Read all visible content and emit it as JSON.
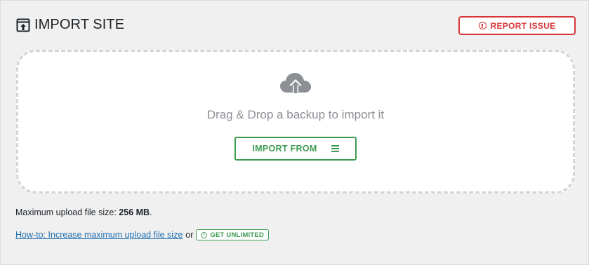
{
  "header": {
    "title": "IMPORT SITE",
    "icon": "import-site-icon"
  },
  "report": {
    "label": "REPORT ISSUE",
    "icon": "warning-circle-icon",
    "color": "#d63638"
  },
  "dropzone": {
    "icon": "cloud-upload-icon",
    "text": "Drag & Drop a backup to import it",
    "import_button_label": "IMPORT FROM",
    "import_button_icon": "hamburger-menu-icon",
    "accent": "#3e9b52"
  },
  "upload_info": {
    "prefix": "Maximum upload file size:",
    "value": "256 MB",
    "suffix": "."
  },
  "help": {
    "link_text": "How-to: Increase maximum upload file size",
    "connector": "or",
    "badge_label": "GET UNLIMITED",
    "badge_icon": "clock-icon"
  }
}
